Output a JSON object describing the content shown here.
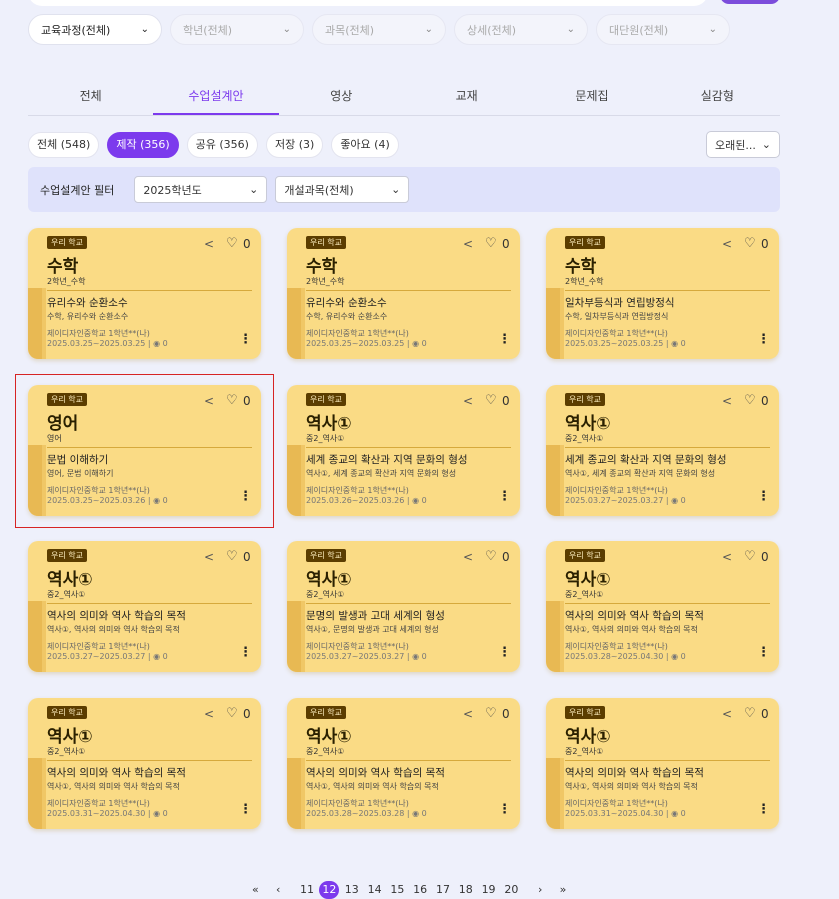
{
  "filters": [
    {
      "label": "교육과정(전체)",
      "active": true
    },
    {
      "label": "학년(전체)",
      "active": false
    },
    {
      "label": "과목(전체)",
      "active": false
    },
    {
      "label": "상세(전체)",
      "active": false
    },
    {
      "label": "대단원(전체)",
      "active": false
    }
  ],
  "tabs": [
    "전체",
    "수업설계안",
    "영상",
    "교재",
    "문제집",
    "실감형"
  ],
  "active_tab": "수업설계안",
  "chips": [
    "전체 (548)",
    "제작 (356)",
    "공유 (356)",
    "저장 (3)",
    "좋아요 (4)"
  ],
  "sort_label": "오래된...",
  "filter_bar": {
    "label": "수업설계안 필터",
    "year": "2025학년도",
    "course": "개설과목(전체)"
  },
  "cards": [
    {
      "badge": "우리 학교",
      "likes": "0",
      "subject": "수학",
      "grade": "2학년_수학",
      "title": "유리수와 순환소수",
      "sub": "수학, 유리수와 순환소수",
      "school": "제이디자인중학교 1학년**(나)",
      "dates": "2025.03.25~2025.03.25",
      "views": "0"
    },
    {
      "badge": "우리 학교",
      "likes": "0",
      "subject": "수학",
      "grade": "2학년_수학",
      "title": "유리수와 순환소수",
      "sub": "수학, 유리수와 순환소수",
      "school": "제이디자인중학교 1학년**(나)",
      "dates": "2025.03.25~2025.03.25",
      "views": "0"
    },
    {
      "badge": "우리 학교",
      "likes": "0",
      "subject": "수학",
      "grade": "2학년_수학",
      "title": "일차부등식과 연립방정식",
      "sub": "수학, 일차부등식과 연립방정식",
      "school": "제이디자인중학교 1학년**(나)",
      "dates": "2025.03.25~2025.03.25",
      "views": "0"
    },
    {
      "badge": "우리 학교",
      "likes": "0",
      "subject": "영어",
      "grade": "영어",
      "title": "문법 이해하기",
      "sub": "영어, 문법 이해하기",
      "school": "제이디자인중학교 1학년**(나)",
      "dates": "2025.03.25~2025.03.26",
      "views": "0"
    },
    {
      "badge": "우리 학교",
      "likes": "0",
      "subject": "역사①",
      "grade": "중2_역사①",
      "title": "세계 종교의 확산과 지역 문화의 형성",
      "sub": "역사①, 세계 종교의 확산과 지역 문화의 형성",
      "school": "제이디자인중학교 1학년**(나)",
      "dates": "2025.03.26~2025.03.26",
      "views": "0"
    },
    {
      "badge": "우리 학교",
      "likes": "0",
      "subject": "역사①",
      "grade": "중2_역사①",
      "title": "세계 종교의 확산과 지역 문화의 형성",
      "sub": "역사①, 세계 종교의 확산과 지역 문화의 형성",
      "school": "제이디자인중학교 1학년**(나)",
      "dates": "2025.03.27~2025.03.27",
      "views": "0"
    },
    {
      "badge": "우리 학교",
      "likes": "0",
      "subject": "역사①",
      "grade": "중2_역사①",
      "title": "역사의 의미와 역사 학습의 목적",
      "sub": "역사①, 역사의 의미와 역사 학습의 목적",
      "school": "제이디자인중학교 1학년**(나)",
      "dates": "2025.03.27~2025.03.27",
      "views": "0"
    },
    {
      "badge": "우리 학교",
      "likes": "0",
      "subject": "역사①",
      "grade": "중2_역사①",
      "title": "문명의 발생과 고대 세계의 형성",
      "sub": "역사①, 문명의 발생과 고대 세계의 형성",
      "school": "제이디자인중학교 1학년**(나)",
      "dates": "2025.03.27~2025.03.27",
      "views": "0"
    },
    {
      "badge": "우리 학교",
      "likes": "0",
      "subject": "역사①",
      "grade": "중2_역사①",
      "title": "역사의 의미와 역사 학습의 목적",
      "sub": "역사①, 역사의 의미와 역사 학습의 목적",
      "school": "제이디자인중학교 1학년**(나)",
      "dates": "2025.03.28~2025.04.30",
      "views": "0"
    },
    {
      "badge": "우리 학교",
      "likes": "0",
      "subject": "역사①",
      "grade": "중2_역사①",
      "title": "역사의 의미와 역사 학습의 목적",
      "sub": "역사①, 역사의 의미와 역사 학습의 목적",
      "school": "제이디자인중학교 1학년**(나)",
      "dates": "2025.03.31~2025.04.30",
      "views": "0"
    },
    {
      "badge": "우리 학교",
      "likes": "0",
      "subject": "역사①",
      "grade": "중2_역사①",
      "title": "역사의 의미와 역사 학습의 목적",
      "sub": "역사①, 역사의 의미와 역사 학습의 목적",
      "school": "제이디자인중학교 1학년**(나)",
      "dates": "2025.03.28~2025.03.28",
      "views": "0"
    },
    {
      "badge": "우리 학교",
      "likes": "0",
      "subject": "역사①",
      "grade": "중2_역사①",
      "title": "역사의 의미와 역사 학습의 목적",
      "sub": "역사①, 역사의 의미와 역사 학습의 목적",
      "school": "제이디자인중학교 1학년**(나)",
      "dates": "2025.03.31~2025.04.30",
      "views": "0"
    }
  ],
  "pagination": {
    "first": "«",
    "prev": "‹",
    "pages": [
      "11",
      "12",
      "13",
      "14",
      "15",
      "16",
      "17",
      "18",
      "19",
      "20"
    ],
    "current": "12",
    "next": "›",
    "last": "»"
  }
}
